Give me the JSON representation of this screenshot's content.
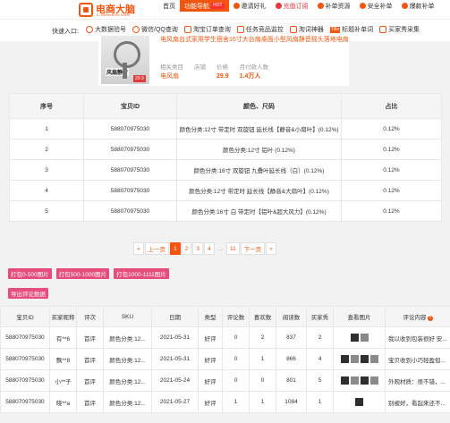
{
  "header": {
    "logo_cn": "电商大脑",
    "logo_en": "E-commerce brain",
    "nav": [
      {
        "label": "首页",
        "icon": "",
        "active": false
      },
      {
        "label": "功能导航",
        "icon": "",
        "active": true,
        "badge": "HOT"
      },
      {
        "label": "邀请好礼",
        "icon": "user-icon",
        "active": false
      },
      {
        "label": "充值订阅",
        "icon": "heart-icon",
        "active": false,
        "red": true
      },
      {
        "label": "补单资源",
        "icon": "grid-icon",
        "active": false
      },
      {
        "label": "安全补单",
        "icon": "shield-icon",
        "active": false
      },
      {
        "label": "爆款补单",
        "icon": "flame-icon",
        "active": false
      }
    ]
  },
  "quick_entry": {
    "label": "快速入口:",
    "items": [
      {
        "label": "大数据验号",
        "icon": "person-icon"
      },
      {
        "label": "微信/QQ查询",
        "icon": "chat-icon"
      },
      {
        "label": "淘宝订单查询",
        "icon": "order-icon"
      },
      {
        "label": "任务竞品监控",
        "icon": "monitor-icon"
      },
      {
        "label": "淘词神器",
        "icon": "search-icon"
      },
      {
        "label": "标题补单词",
        "icon": "title-icon",
        "badge": "Title"
      },
      {
        "label": "买家秀采集",
        "icon": "photo-icon"
      }
    ]
  },
  "product": {
    "image_text": "风扇静音",
    "image_price_tag": "29.9",
    "title": "电风扇台式家用学生宿舍16寸大台扇桌面小型风扇静音摇头落地电扇",
    "meta": [
      {
        "label": "相关类目",
        "value": "电风扇"
      },
      {
        "label": "店铺",
        "value": ""
      },
      {
        "label": "价格",
        "value": "29.9"
      },
      {
        "label": "月付款人数",
        "value": "1.4万人"
      }
    ]
  },
  "share_table": {
    "headers": [
      "序号",
      "宝贝ID",
      "颜色、尺码",
      "占比"
    ],
    "rows": [
      [
        "1",
        "588070975030",
        "颜色分类:12寸 带定时 双旋钮 延长线【静音&小扇叶】(0.12%)",
        "0.12%"
      ],
      [
        "2",
        "588070975030",
        "颜色分类:12寸 铝叶 (0.12%)",
        "0.12%"
      ],
      [
        "3",
        "588070975030",
        "颜色分类:16寸 双旋钮 九叠叶延长线（白）(0.12%)",
        "0.12%"
      ],
      [
        "4",
        "588070975030",
        "颜色分类:12寸 带定时 延长线【静音&大扇叶】(0.12%)",
        "0.12%"
      ],
      [
        "5",
        "588070975030",
        "颜色分类:16寸 白 带定时【铝叶&超大风力】(0.12%)",
        "0.12%"
      ]
    ]
  },
  "pagination": {
    "first": "«",
    "prev": "上一页",
    "pages": [
      "1",
      "2",
      "3",
      "4"
    ],
    "ellipsis": "...",
    "last_page": "11",
    "next": "下一页",
    "end": "»",
    "current": "1"
  },
  "image_buttons": [
    "打包0-500图片",
    "打包500-1000图片",
    "打包1000-1111图片"
  ],
  "export_button": "导出评论数据",
  "reviews": {
    "headers": [
      "宝贝ID",
      "买家昵称",
      "评次",
      "SKU",
      "日期",
      "类型",
      "评论数",
      "喜欢数",
      "阅读数",
      "买家秀",
      "查看图片",
      "评论内容"
    ],
    "rows": [
      [
        "588070975030",
        "有**6",
        "首评",
        "颜色分类:12...",
        "2021-05-31",
        "好评",
        "0",
        "2",
        "837",
        "2",
        "",
        "我以收到包装很好 安..."
      ],
      [
        "588070975030",
        "飘**8",
        "首评",
        "颜色分类:12...",
        "2021-05-31",
        "好评",
        "0",
        "1",
        "866",
        "4",
        "",
        "宝贝收到小巧轻盈但..."
      ],
      [
        "588070975030",
        "小**子",
        "首评",
        "颜色分类:12...",
        "2021-05-24",
        "好评",
        "0",
        "0",
        "801",
        "5",
        "",
        "外观材质：很不错，..."
      ],
      [
        "588070975030",
        "晓**a",
        "首评",
        "颜色分类:12...",
        "2021-05-27",
        "好评",
        "1",
        "1",
        "1084",
        "1",
        "",
        "别被好，看起来还不..."
      ]
    ],
    "thumb_counts": [
      2,
      4,
      4,
      1
    ]
  },
  "colors": {
    "brand": "#f2550f",
    "pink_button": "#e64d7c",
    "hot_badge": "#ff2f2f"
  }
}
